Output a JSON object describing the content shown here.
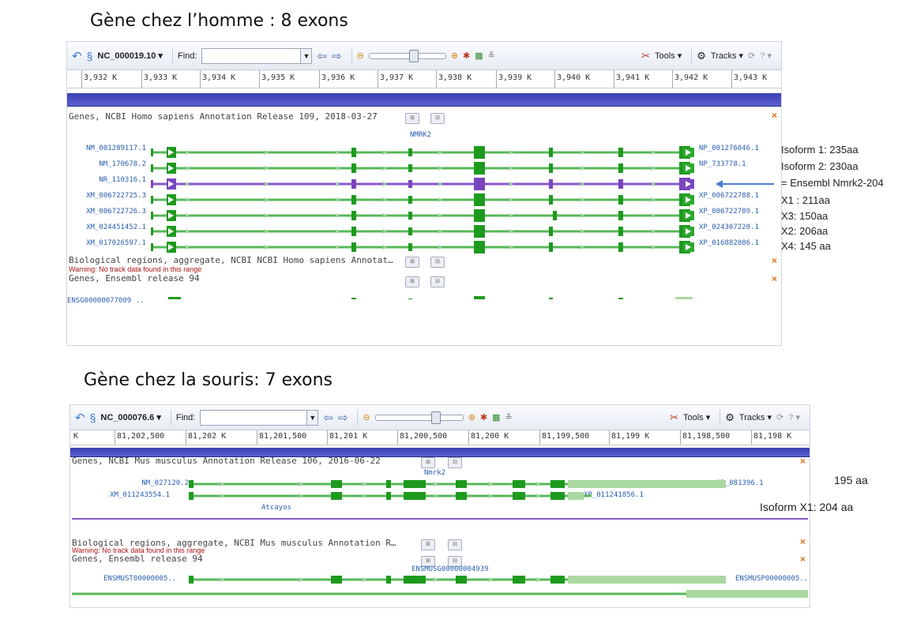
{
  "human": {
    "heading": "Gène  chez l’homme :  8 exons",
    "toolbar": {
      "accession": "NC_000019.10 ▾",
      "find_label": "Find:",
      "find_value": "",
      "tools_label": "Tools ▾",
      "tracks_label": "Tracks ▾"
    },
    "ruler": [
      "3,932 K",
      "3,933 K",
      "3,934 K",
      "3,935 K",
      "3,936 K",
      "3,937 K",
      "3,938 K",
      "3,939 K",
      "3,940 K",
      "3,941 K",
      "3,942 K",
      "3,943 K"
    ],
    "track1_title": "Genes, NCBI Homo sapiens Annotation Release 109, 2018-03-27",
    "gene_name": "NMRK2",
    "transcripts": [
      {
        "id": "NM_001289117.1",
        "protein": "NP_001276046.1",
        "color": "#3fa83f"
      },
      {
        "id": "NM_170678.2",
        "protein": "NP_733778.1",
        "color": "#3fa83f"
      },
      {
        "id": "NR_110316.1",
        "protein": "",
        "color": "#8a58c8"
      },
      {
        "id": "XM_006722725.3",
        "protein": "XP_006722788.1",
        "color": "#3fa83f"
      },
      {
        "id": "XM_006722726.3",
        "protein": "XP_006722789.1",
        "color": "#3fa83f"
      },
      {
        "id": "XM_024451452.1",
        "protein": "XP_024307220.1",
        "color": "#3fa83f"
      },
      {
        "id": "XM_017026597.1",
        "protein": "XP_016882086.1",
        "color": "#3fa83f"
      }
    ],
    "track2_title": "Biological regions, aggregate, NCBI NCBI Homo sapiens Annotat…",
    "warning": "Warning: No track data found in this range",
    "track3_title": "Genes, Ensembl release 94",
    "ensembl_tx": "ENSG00000077009 .."
  },
  "human_annotations": [
    "Isoform 1: 235aa",
    "Isoform 2: 230aa",
    "= Ensembl Nmrk2-204",
    "X1 : 211aa",
    "X3: 150aa",
    "X2: 206aa",
    "X4: 145 aa"
  ],
  "mouse": {
    "heading": "Gène chez la souris:  7 exons",
    "toolbar": {
      "accession": "NC_000076.6 ▾",
      "find_label": "Find:",
      "find_value": "",
      "tools_label": "Tools ▾",
      "tracks_label": "Tracks ▾"
    },
    "ruler": [
      "K",
      "81,202,500",
      "81,202 K",
      "81,201,500",
      "81,201 K",
      "81,200,500",
      "81,200 K",
      "81,199,500",
      "81,199 K",
      "81,198,500",
      "81,198 K"
    ],
    "track1_title": "Genes, NCBI Mus musculus Annotation Release 106, 2016-06-22",
    "gene_name": "Nmrk2",
    "transcripts": [
      {
        "id": "NM_027120.2",
        "protein": "NP_081396.1"
      },
      {
        "id": "XM_011243554.1",
        "protein": "XP_011241856.1"
      }
    ],
    "neighbor_gene": "Atcayos",
    "track2_title": "Biological regions, aggregate, NCBI Mus musculus Annotation R…",
    "warning": "Warning: No track data found in this range",
    "track3_title": "Genes, Ensembl release 94",
    "ensembl_gene": "ENSMUSG00000004939",
    "ensembl_tx": "ENSMUST00000005..",
    "ensembl_prot": "ENSMUSP00000005.."
  },
  "mouse_annotations": [
    "195 aa",
    "Isoform X1: 204 aa"
  ],
  "colors": {
    "exon": "#1e9a1e",
    "intron": "#58b858",
    "utr": "#a9d8a0",
    "nc": "#8a58c8",
    "seqbar": "#3f43b8"
  }
}
